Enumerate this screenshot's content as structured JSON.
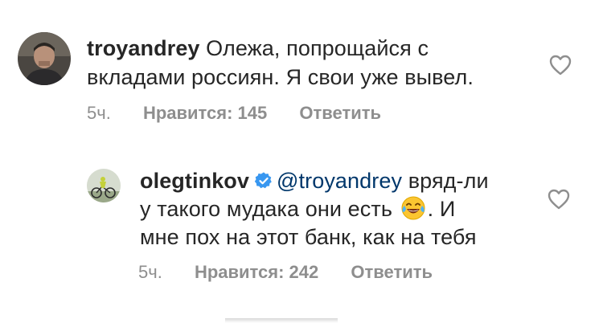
{
  "comments": [
    {
      "username": "troyandrey",
      "text_line1": "Олежа, попрощайся с",
      "text_line2": "вкладами россиян. Я свои уже вывел.",
      "time": "5ч.",
      "likes": "Нравится: 145",
      "reply": "Ответить",
      "icon": "heart-outline-icon"
    },
    {
      "username": "olegtinkov",
      "mention": "@troyandrey",
      "text_line1_rest": "вряд-ли",
      "text_line2a": "у такого мудака они есть",
      "text_line2b": ". И",
      "text_line3": "мне пох на этот банк, как на тебя",
      "time": "5ч.",
      "likes": "Нравится: 242",
      "reply": "Ответить",
      "icon": "heart-outline-icon",
      "verified_icon": "verified-badge-icon",
      "emoji": "face-with-tears-of-joy"
    }
  ],
  "colors": {
    "text": "#262626",
    "secondary": "#8e8e8e",
    "mention": "#00376b",
    "verified": "#3897f0"
  }
}
